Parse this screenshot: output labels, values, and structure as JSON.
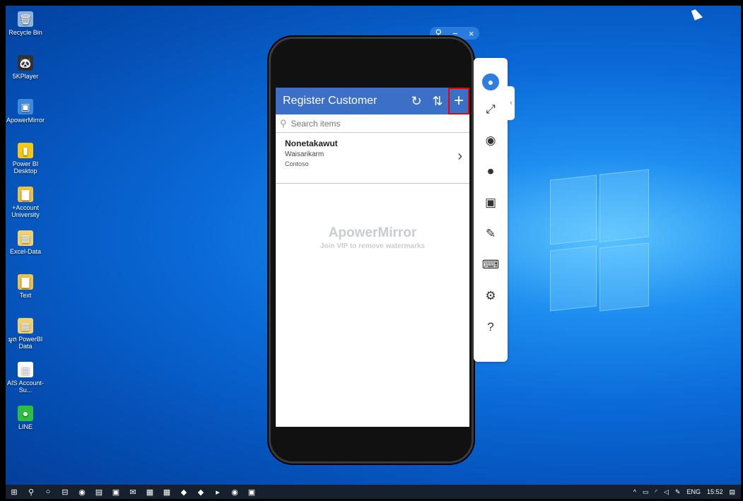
{
  "desktop": {
    "icons": [
      {
        "label": "Recycle Bin",
        "icon": "recycle-bin-icon",
        "glyph": "🗑",
        "color": "#8fb3d9"
      },
      {
        "label": "5KPlayer",
        "icon": "5kplayer-icon",
        "glyph": "🐼",
        "color": "#333333"
      },
      {
        "label": "ApowerMirror",
        "icon": "apowermirror-icon",
        "glyph": "▣",
        "color": "#3a8be0"
      },
      {
        "label": "Power BI Desktop",
        "icon": "powerbi-icon",
        "glyph": "▮",
        "color": "#f2c811"
      },
      {
        "label": "+Account University",
        "icon": "folder-icon",
        "glyph": "▇",
        "color": "#f0c040"
      },
      {
        "label": "Excel-Data",
        "icon": "excel-file-icon",
        "glyph": "▦",
        "color": "#f0d070"
      },
      {
        "label": "Text",
        "icon": "text-file-icon",
        "glyph": "▇",
        "color": "#f0c040"
      },
      {
        "label": "ນຸດ PowerBI Data",
        "icon": "folder-icon",
        "glyph": "▦",
        "color": "#f0d070"
      },
      {
        "label": "AIS Account-Su...",
        "icon": "document-icon",
        "glyph": "▤",
        "color": "#ffffff"
      },
      {
        "label": "LINE",
        "icon": "line-app-icon",
        "glyph": "●",
        "color": "#2dbf3e"
      }
    ]
  },
  "mirror_controls": {
    "restore": "⚲",
    "minimize": "−",
    "close": "×"
  },
  "app": {
    "title": "Register Customer",
    "refresh_icon": "↻",
    "sort_icon": "⇅",
    "add_icon": "+",
    "search": {
      "placeholder": "Search items",
      "value": ""
    },
    "items": [
      {
        "name": "Nonetakawut",
        "line2": "Waisarikarm",
        "line3": "Contoso"
      }
    ],
    "watermark": {
      "title": "ApowerMirror",
      "subtitle": "Join VIP to remove watermarks"
    }
  },
  "toolbar": {
    "items": [
      {
        "name": "user-avatar-icon",
        "glyph": "●"
      },
      {
        "name": "fullscreen-icon",
        "glyph": "⤢"
      },
      {
        "name": "screenshot-icon",
        "glyph": "◉"
      },
      {
        "name": "record-icon",
        "glyph": "⏺"
      },
      {
        "name": "screen-cast-icon",
        "glyph": "▣"
      },
      {
        "name": "whiteboard-pen-icon",
        "glyph": "✎"
      },
      {
        "name": "keyboard-icon",
        "glyph": "⌨"
      },
      {
        "name": "settings-icon",
        "glyph": "⚙"
      },
      {
        "name": "help-icon",
        "glyph": "?"
      }
    ],
    "collapse": "‹"
  },
  "taskbar": {
    "apps": [
      "⊞",
      "⚲",
      "○",
      "⊟",
      "◉",
      "▤",
      "▣",
      "✉",
      "▦",
      "▦",
      "◆",
      "◆",
      "▸",
      "◉",
      "▣"
    ],
    "tray": {
      "chevron": "^",
      "lang": "ENG",
      "time": "15:52"
    }
  },
  "colors": {
    "accent": "#3c6fc6",
    "highlight": "#e00000"
  }
}
